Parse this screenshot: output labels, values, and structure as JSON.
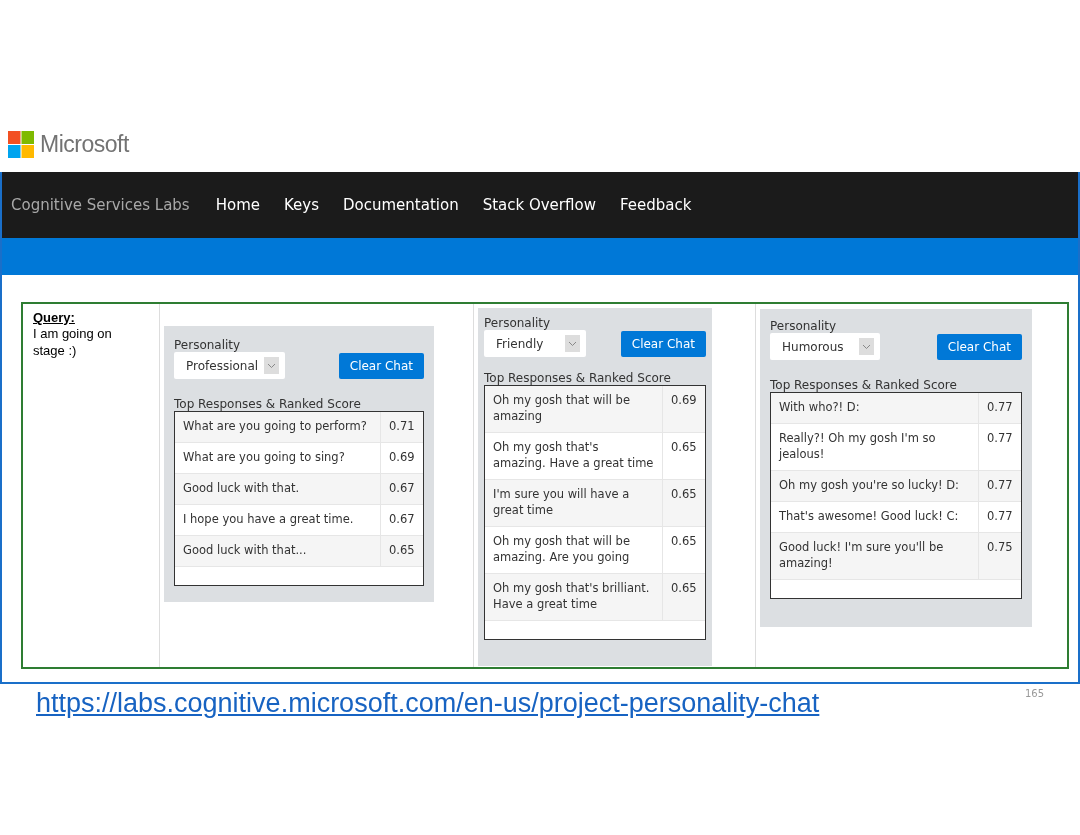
{
  "logo": {
    "text": "Microsoft"
  },
  "nav": {
    "brand": "Cognitive Services Labs",
    "links": [
      "Home",
      "Keys",
      "Documentation",
      "Stack Overflow",
      "Feedback"
    ]
  },
  "query": {
    "label": "Query:",
    "text": "I am going on stage :)"
  },
  "panels": [
    {
      "label": "Personality",
      "personality": "Professional",
      "button": "Clear Chat",
      "heading": "Top Responses & Ranked Score",
      "rows": [
        {
          "response": "What are you going to perform?",
          "score": "0.71"
        },
        {
          "response": "What are you going to sing?",
          "score": "0.69"
        },
        {
          "response": "Good luck with that.",
          "score": "0.67"
        },
        {
          "response": "I hope you have a great time.",
          "score": "0.67"
        },
        {
          "response": "Good luck with that...",
          "score": "0.65"
        }
      ]
    },
    {
      "label": "Personality",
      "personality": "Friendly",
      "button": "Clear Chat",
      "heading": "Top Responses & Ranked Score",
      "rows": [
        {
          "response": "Oh my gosh that will be amazing",
          "score": "0.69"
        },
        {
          "response": "Oh my gosh that's amazing. Have a great time",
          "score": "0.65"
        },
        {
          "response": "I'm sure you will have a great time",
          "score": "0.65"
        },
        {
          "response": "Oh my gosh that will be amazing. Are you going",
          "score": "0.65"
        },
        {
          "response": "Oh my gosh that's brilliant. Have a great time",
          "score": "0.65"
        }
      ]
    },
    {
      "label": "Personality",
      "personality": "Humorous",
      "button": "Clear Chat",
      "heading": "Top Responses & Ranked Score",
      "rows": [
        {
          "response": "With who?! D:",
          "score": "0.77"
        },
        {
          "response": "Really?! Oh my gosh I'm so jealous!",
          "score": "0.77"
        },
        {
          "response": "Oh my gosh you're so lucky! D:",
          "score": "0.77"
        },
        {
          "response": "That's awesome! Good luck! C:",
          "score": "0.77"
        },
        {
          "response": "Good luck! I'm sure you'll be amazing!",
          "score": "0.75"
        }
      ]
    }
  ],
  "url": "https://labs.cognitive.microsoft.com/en-us/project-personality-chat",
  "page_number": "165"
}
